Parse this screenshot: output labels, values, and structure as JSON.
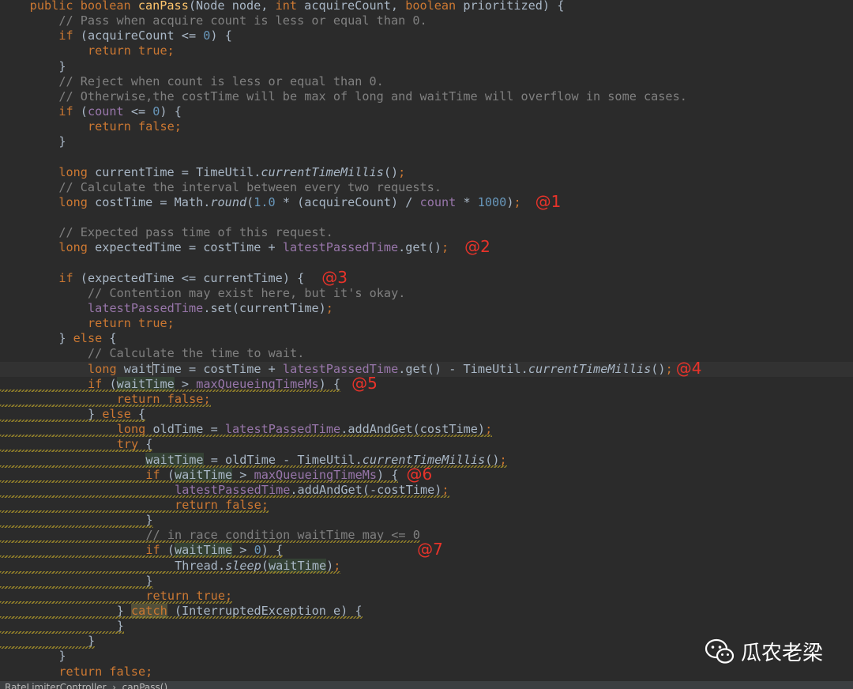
{
  "editor": {
    "lines": [
      {
        "indent": 4,
        "tokens": [
          {
            "t": "public ",
            "c": "kw"
          },
          {
            "t": "boolean ",
            "c": "kw"
          },
          {
            "t": "canPass",
            "c": "fn"
          },
          {
            "t": "(Node node, "
          },
          {
            "t": "int ",
            "c": "kw"
          },
          {
            "t": "acquireCount, "
          },
          {
            "t": "boolean ",
            "c": "kw"
          },
          {
            "t": "prioritized) {"
          }
        ]
      },
      {
        "indent": 8,
        "tokens": [
          {
            "t": "// Pass when acquire count is less or equal than 0.",
            "c": "cm"
          }
        ]
      },
      {
        "indent": 8,
        "tokens": [
          {
            "t": "if ",
            "c": "kw"
          },
          {
            "t": "(acquireCount <= "
          },
          {
            "t": "0",
            "c": "num"
          },
          {
            "t": ") {"
          }
        ]
      },
      {
        "indent": 12,
        "tokens": [
          {
            "t": "return true",
            "c": "kw"
          },
          {
            "t": ";",
            "c": "kw"
          }
        ]
      },
      {
        "indent": 8,
        "tokens": [
          {
            "t": "}"
          }
        ]
      },
      {
        "indent": 8,
        "tokens": [
          {
            "t": "// Reject when count is less or equal than 0.",
            "c": "cm"
          }
        ]
      },
      {
        "indent": 8,
        "tokens": [
          {
            "t": "// Otherwise,the costTime will be max of long and waitTime will overflow in some cases.",
            "c": "cm"
          }
        ]
      },
      {
        "indent": 8,
        "tokens": [
          {
            "t": "if ",
            "c": "kw"
          },
          {
            "t": "("
          },
          {
            "t": "count",
            "c": "fld"
          },
          {
            "t": " <= "
          },
          {
            "t": "0",
            "c": "num"
          },
          {
            "t": ") {"
          }
        ]
      },
      {
        "indent": 12,
        "tokens": [
          {
            "t": "return false",
            "c": "kw"
          },
          {
            "t": ";",
            "c": "kw"
          }
        ]
      },
      {
        "indent": 8,
        "tokens": [
          {
            "t": "}"
          }
        ]
      },
      {
        "indent": 0,
        "tokens": []
      },
      {
        "indent": 8,
        "tokens": [
          {
            "t": "long ",
            "c": "kw"
          },
          {
            "t": "currentTime = TimeUtil."
          },
          {
            "t": "currentTimeMillis",
            "c": "it"
          },
          {
            "t": "()"
          },
          {
            "t": ";",
            "c": "kw"
          }
        ]
      },
      {
        "indent": 8,
        "tokens": [
          {
            "t": "// Calculate the interval between every two requests.",
            "c": "cm"
          }
        ]
      },
      {
        "indent": 8,
        "tokens": [
          {
            "t": "long ",
            "c": "kw"
          },
          {
            "t": "costTime = Math."
          },
          {
            "t": "round",
            "c": "it"
          },
          {
            "t": "("
          },
          {
            "t": "1.0",
            "c": "num"
          },
          {
            "t": " * (acquireCount) / "
          },
          {
            "t": "count",
            "c": "fld"
          },
          {
            "t": " * "
          },
          {
            "t": "1000",
            "c": "num"
          },
          {
            "t": ")"
          },
          {
            "t": ";",
            "c": "kw"
          }
        ]
      },
      {
        "indent": 0,
        "tokens": []
      },
      {
        "indent": 8,
        "tokens": [
          {
            "t": "// Expected pass time of this request.",
            "c": "cm"
          }
        ]
      },
      {
        "indent": 8,
        "tokens": [
          {
            "t": "long ",
            "c": "kw"
          },
          {
            "t": "expectedTime = costTime + "
          },
          {
            "t": "latestPassedTime",
            "c": "fld"
          },
          {
            "t": ".get()"
          },
          {
            "t": ";",
            "c": "kw"
          }
        ]
      },
      {
        "indent": 0,
        "tokens": []
      },
      {
        "indent": 8,
        "tokens": [
          {
            "t": "if ",
            "c": "kw"
          },
          {
            "t": "(expectedTime <= currentTime) {"
          }
        ]
      },
      {
        "indent": 12,
        "tokens": [
          {
            "t": "// Contention may exist here, but it's okay.",
            "c": "cm"
          }
        ]
      },
      {
        "indent": 12,
        "tokens": [
          {
            "t": "latestPassedTime",
            "c": "fld"
          },
          {
            "t": ".set(currentTime)"
          },
          {
            "t": ";",
            "c": "kw"
          }
        ]
      },
      {
        "indent": 12,
        "tokens": [
          {
            "t": "return true",
            "c": "kw"
          },
          {
            "t": ";",
            "c": "kw"
          }
        ]
      },
      {
        "indent": 8,
        "tokens": [
          {
            "t": "} "
          },
          {
            "t": "else ",
            "c": "kw"
          },
          {
            "t": "{"
          }
        ]
      },
      {
        "indent": 12,
        "tokens": [
          {
            "t": "// Calculate the time to wait.",
            "c": "cm"
          }
        ]
      },
      {
        "indent": 12,
        "caretline": true,
        "tokens": [
          {
            "t": "long ",
            "c": "kw"
          },
          {
            "t": "wait"
          },
          {
            "t": "",
            "c": "caret"
          },
          {
            "t": "Time = costTime + "
          },
          {
            "t": "latestPassedTime",
            "c": "fld"
          },
          {
            "t": ".get() - TimeUtil."
          },
          {
            "t": "currentTimeMillis",
            "c": "it"
          },
          {
            "t": "()"
          },
          {
            "t": ";",
            "c": "kw"
          }
        ]
      },
      {
        "indent": 12,
        "squiggle": true,
        "tokens": [
          {
            "t": "if ",
            "c": "kw"
          },
          {
            "t": "("
          },
          {
            "t": "waitTime",
            "c": "hlv"
          },
          {
            "t": " > "
          },
          {
            "t": "maxQueueingTimeMs",
            "c": "fld"
          },
          {
            "t": ") {"
          }
        ]
      },
      {
        "indent": 16,
        "squiggle": true,
        "tokens": [
          {
            "t": "return false",
            "c": "kw"
          },
          {
            "t": ";",
            "c": "kw"
          }
        ]
      },
      {
        "indent": 12,
        "squiggle": true,
        "tokens": [
          {
            "t": "} "
          },
          {
            "t": "else ",
            "c": "kw"
          },
          {
            "t": "{"
          }
        ]
      },
      {
        "indent": 16,
        "squiggle": true,
        "tokens": [
          {
            "t": "long ",
            "c": "kw"
          },
          {
            "t": "oldTime = "
          },
          {
            "t": "latestPassedTime",
            "c": "fld"
          },
          {
            "t": ".addAndGet(costTime)"
          },
          {
            "t": ";",
            "c": "kw"
          }
        ]
      },
      {
        "indent": 16,
        "squiggle": true,
        "tokens": [
          {
            "t": "try ",
            "c": "kw"
          },
          {
            "t": "{"
          }
        ]
      },
      {
        "indent": 20,
        "squiggle": true,
        "tokens": [
          {
            "t": "waitTime",
            "c": "hlv"
          },
          {
            "t": " = oldTime - TimeUtil."
          },
          {
            "t": "currentTimeMillis",
            "c": "it"
          },
          {
            "t": "()"
          },
          {
            "t": ";",
            "c": "kw"
          }
        ]
      },
      {
        "indent": 20,
        "squiggle": true,
        "tokens": [
          {
            "t": "if ",
            "c": "kw"
          },
          {
            "t": "("
          },
          {
            "t": "waitTime",
            "c": "hlv"
          },
          {
            "t": " > "
          },
          {
            "t": "maxQueueingTimeMs",
            "c": "fld"
          },
          {
            "t": ") {"
          }
        ]
      },
      {
        "indent": 24,
        "squiggle": true,
        "tokens": [
          {
            "t": "latestPassedTime",
            "c": "fld"
          },
          {
            "t": ".addAndGet(-costTime)"
          },
          {
            "t": ";",
            "c": "kw"
          }
        ]
      },
      {
        "indent": 24,
        "squiggle": true,
        "tokens": [
          {
            "t": "return false",
            "c": "kw"
          },
          {
            "t": ";",
            "c": "kw"
          }
        ]
      },
      {
        "indent": 20,
        "squiggle": true,
        "tokens": [
          {
            "t": "}"
          }
        ]
      },
      {
        "indent": 20,
        "squiggle": true,
        "tokens": [
          {
            "t": "// in race condition waitTime may <= 0",
            "c": "cm"
          }
        ]
      },
      {
        "indent": 20,
        "squiggle": true,
        "tokens": [
          {
            "t": "if ",
            "c": "kw"
          },
          {
            "t": "("
          },
          {
            "t": "waitTime",
            "c": "hlv"
          },
          {
            "t": " > "
          },
          {
            "t": "0",
            "c": "num"
          },
          {
            "t": ") {"
          }
        ]
      },
      {
        "indent": 24,
        "squiggle": true,
        "tokens": [
          {
            "t": "Thread."
          },
          {
            "t": "sleep",
            "c": "it"
          },
          {
            "t": "("
          },
          {
            "t": "waitTime",
            "c": "hlv"
          },
          {
            "t": ")"
          },
          {
            "t": ";",
            "c": "kw"
          }
        ]
      },
      {
        "indent": 20,
        "squiggle": true,
        "tokens": [
          {
            "t": "}"
          }
        ]
      },
      {
        "indent": 20,
        "squiggle": true,
        "tokens": [
          {
            "t": "return true",
            "c": "kw"
          },
          {
            "t": ";",
            "c": "kw"
          }
        ]
      },
      {
        "indent": 16,
        "squiggle": true,
        "tokens": [
          {
            "t": "} "
          },
          {
            "t": "catch",
            "c": "kw hlc"
          },
          {
            "t": " (InterruptedException e) {"
          }
        ]
      },
      {
        "indent": 16,
        "squiggle": true,
        "tokens": [
          {
            "t": "}"
          }
        ]
      },
      {
        "indent": 12,
        "squiggle": true,
        "tokens": [
          {
            "t": "}"
          }
        ]
      },
      {
        "indent": 8,
        "tokens": [
          {
            "t": "}"
          }
        ]
      },
      {
        "indent": 8,
        "tokens": [
          {
            "t": "return false",
            "c": "kw"
          },
          {
            "t": ";",
            "c": "kw"
          }
        ]
      }
    ]
  },
  "markers": [
    {
      "label": "@1",
      "line": 13
    },
    {
      "label": "@2",
      "line": 16
    },
    {
      "label": "@3",
      "line": 18
    },
    {
      "label": "@4",
      "line": 24
    },
    {
      "label": "@5",
      "line": 25
    },
    {
      "label": "@6",
      "line": 31
    },
    {
      "label": "@7",
      "line": 36
    }
  ],
  "watermark": {
    "text": "瓜农老梁",
    "icon": "wechat-icon"
  },
  "statusbar": {
    "breadcrumb": "RateLimiterController  ›  canPass()"
  },
  "colors": {
    "background": "#2b2b2b",
    "keyword": "#cc7832",
    "method": "#ffc66d",
    "comment": "#808080",
    "number": "#6897bb",
    "field": "#9876aa",
    "marker": "#e8332a"
  }
}
